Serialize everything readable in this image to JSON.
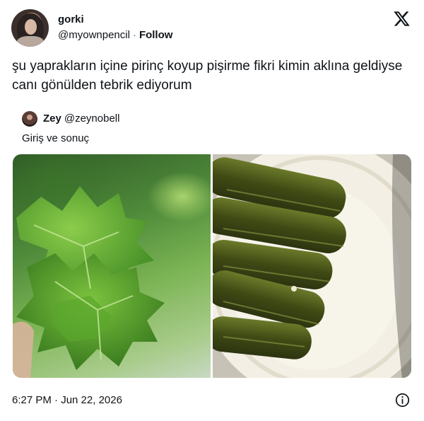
{
  "author": {
    "name": "gorki",
    "handle": "@myownpencil",
    "separator": "·",
    "follow_label": "Follow"
  },
  "brand": {
    "icon": "x-logo-icon"
  },
  "tweet": {
    "text": "şu yaprakların içine pirinç koyup pişirme fikri kimin aklına geldiyse canı gönülden tebrik ediyorum"
  },
  "quote": {
    "name": "Zey",
    "handle": "@zeynobell",
    "text": "Giriş ve sonuç"
  },
  "media": {
    "left_image": "grape-leaves-photo",
    "right_image": "stuffed-grape-leaves-photo"
  },
  "meta": {
    "timestamp": "6:27 PM · Jun 22, 2026",
    "info_icon": "info-icon"
  },
  "colors": {
    "text": "#0f1419",
    "secondary": "#536471",
    "background": "#ffffff"
  }
}
